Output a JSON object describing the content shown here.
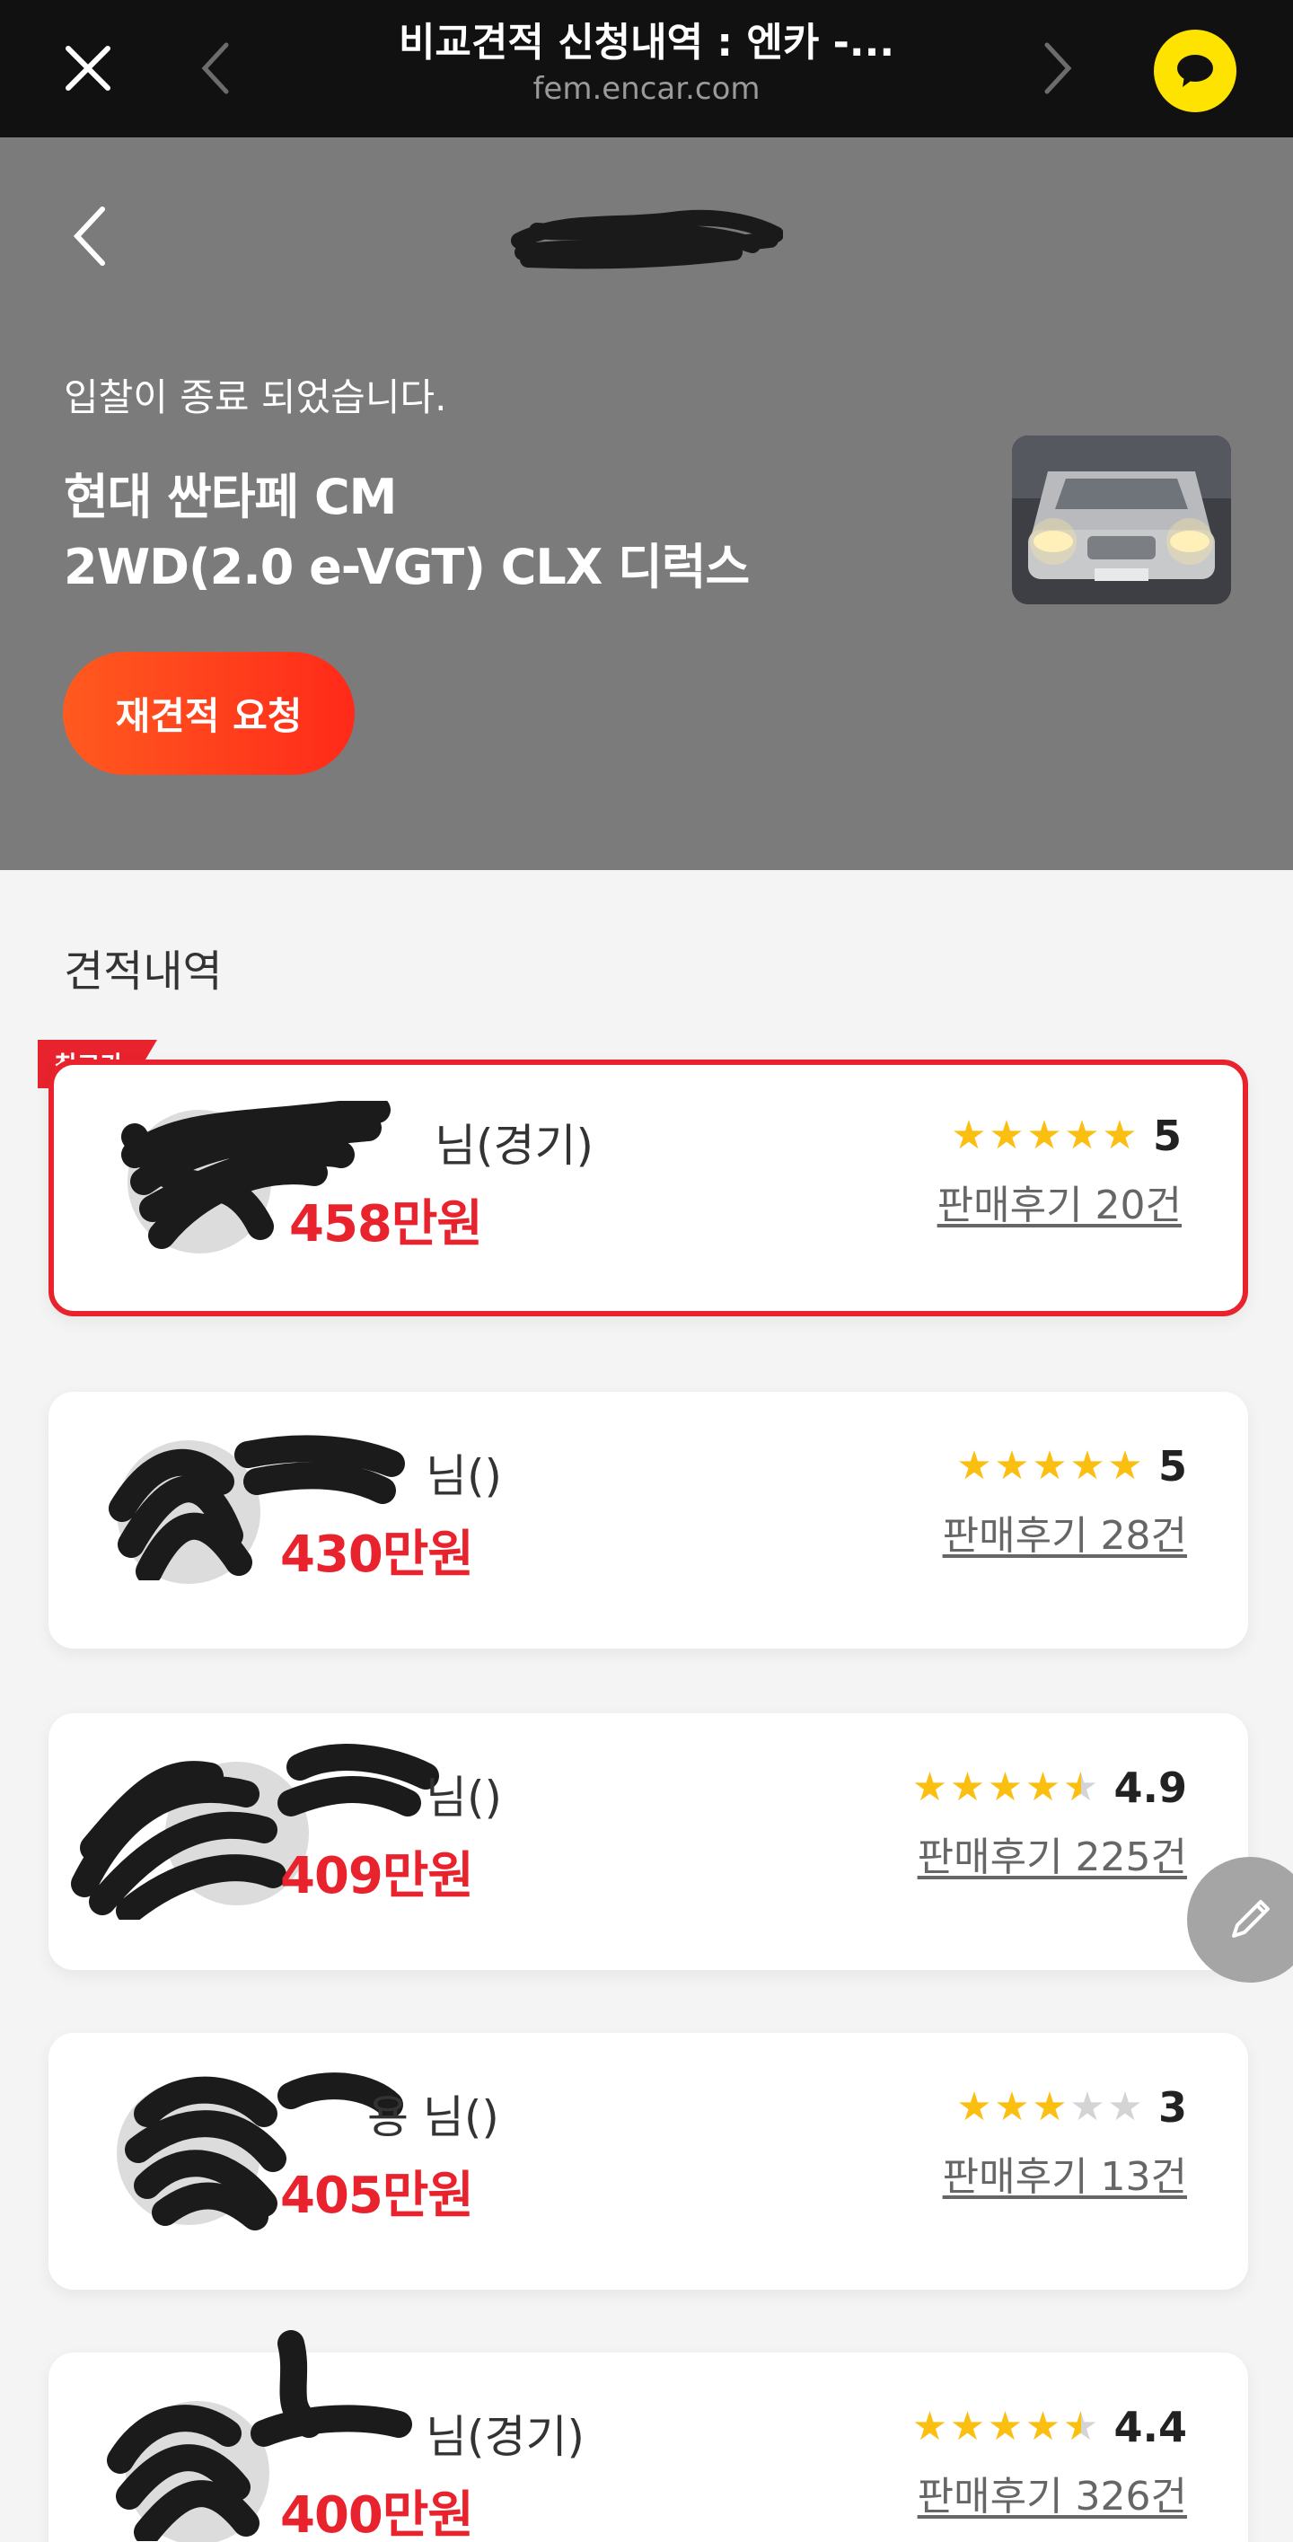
{
  "browser_bar": {
    "title": "비교견적 신청내역 : 엔카 -...",
    "url": "fem.encar.com",
    "icons": {
      "close": "close-icon",
      "back": "chevron-left-icon",
      "forward": "chevron-right-icon",
      "kakao": "chat-bubble-icon"
    },
    "kakao_color": "#ffe300"
  },
  "header": {
    "back_icon": "chevron-left-icon",
    "status": "입찰이 종료 되었습니다.",
    "car_name_line1": "현대 싼타페 CM",
    "car_name_line2": "2WD(2.0 e-VGT) CLX 디럭스",
    "rerequest_label": "재견적 요청",
    "background": "#7b7b7b"
  },
  "estimates": {
    "section_title": "견적내역",
    "best_badge": "최고가",
    "accent_color": "#e8232d",
    "star_color": "#fbbf12",
    "items": [
      {
        "name": "님(경기)",
        "price": "458만원",
        "rating": 5,
        "rating_text": "5",
        "reviews": "판매후기 20건",
        "best": true
      },
      {
        "name": "님()",
        "price": "430만원",
        "rating": 5,
        "rating_text": "5",
        "reviews": "판매후기 28건",
        "best": false
      },
      {
        "name": "님()",
        "price": "409만원",
        "rating": 4.9,
        "rating_text": "4.9",
        "reviews": "판매후기 225건",
        "best": false
      },
      {
        "name": "용 님()",
        "price": "405만원",
        "rating": 3,
        "rating_text": "3",
        "reviews": "판매후기 13건",
        "best": false
      },
      {
        "name": "님(경기)",
        "price": "400만원",
        "rating": 4.4,
        "rating_text": "4.4",
        "reviews": "판매후기 326건",
        "best": false
      }
    ]
  },
  "floating": {
    "edit_icon": "pencil-icon"
  }
}
